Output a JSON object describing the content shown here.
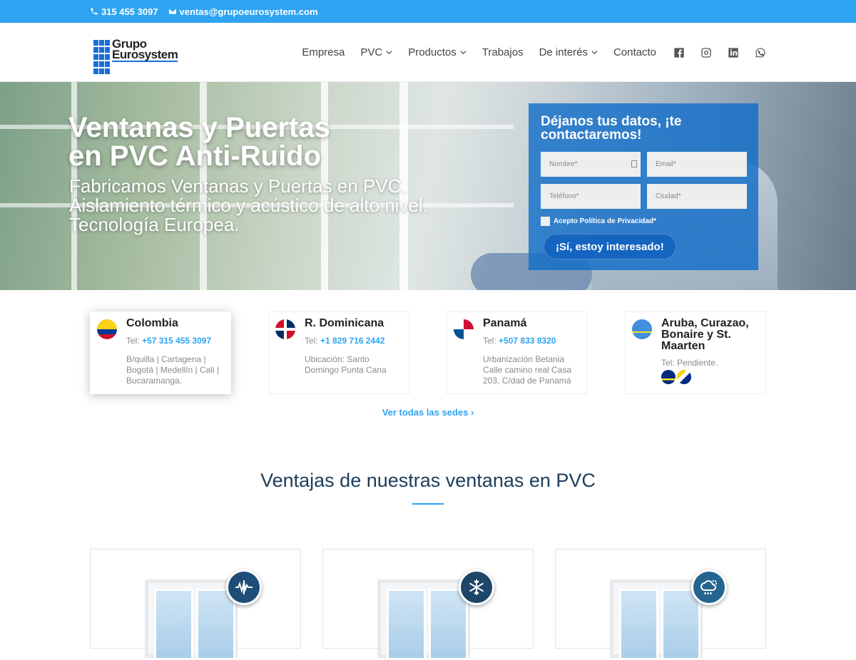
{
  "topbar": {
    "phone": "315 455 3097",
    "email": "ventas@grupoeurosystem.com"
  },
  "logo": {
    "line1": "Grupo",
    "line2": "Eurosystem"
  },
  "nav": {
    "items": [
      {
        "label": "Empresa",
        "dropdown": false
      },
      {
        "label": "PVC",
        "dropdown": true
      },
      {
        "label": "Productos",
        "dropdown": true
      },
      {
        "label": "Trabajos",
        "dropdown": false
      },
      {
        "label": "De interés",
        "dropdown": true
      },
      {
        "label": "Contacto",
        "dropdown": false
      }
    ],
    "social": [
      "facebook-icon",
      "instagram-icon",
      "linkedin-icon",
      "whatsapp-icon"
    ]
  },
  "hero": {
    "title_line1": "Ventanas y Puertas",
    "title_line2": "en PVC Anti-Ruido",
    "subtitle": "Fabricamos Ventanas y Puertas en PVC. Aislamiento térmico y acústico de alto nivel. Tecnología Europea."
  },
  "form": {
    "title": "Déjanos tus datos, ¡te contactaremos!",
    "name_placeholder": "Nombre*",
    "email_placeholder": "Email*",
    "phone_placeholder": "Teléfono*",
    "city_placeholder": "Ciudad*",
    "privacy_label": "Acepto Política de Privacidad*",
    "submit_label": "¡Sí, estoy interesado!"
  },
  "sedes": [
    {
      "name": "Colombia",
      "tel_prefix": "Tel:",
      "tel": "+57 315 455 3097",
      "location": "B/quilla | Cartagena | Bogotá | Medellín | Cali | Bucaramanga."
    },
    {
      "name": "R. Dominicana",
      "tel_prefix": "Tel:",
      "tel": "+1 829 716 2442",
      "location": "Ubicación: Santo Domingo Punta Cana"
    },
    {
      "name": "Panamá",
      "tel_prefix": "Tel:",
      "tel": "+507 833 8320",
      "location": "Urbanización Betania Calle camino real Casa 203, C/dad de Panamá"
    },
    {
      "name": "Aruba, Curazao, Bonaire y St. Maarten",
      "tel_prefix": "Tel: Pendiente.",
      "tel": "",
      "location": ""
    }
  ],
  "see_all": "Ver todas las sedes ›",
  "advantages": {
    "title": "Ventajas de nuestras ventanas en PVC",
    "cards": [
      {
        "icon": "soundwave-icon"
      },
      {
        "icon": "snowflake-icon"
      },
      {
        "icon": "weather-icon"
      }
    ]
  },
  "colors": {
    "accent": "#2ea3f2",
    "form_bg": "#126ec8",
    "title": "#1d3d5a",
    "badge": "#1e4d78"
  }
}
